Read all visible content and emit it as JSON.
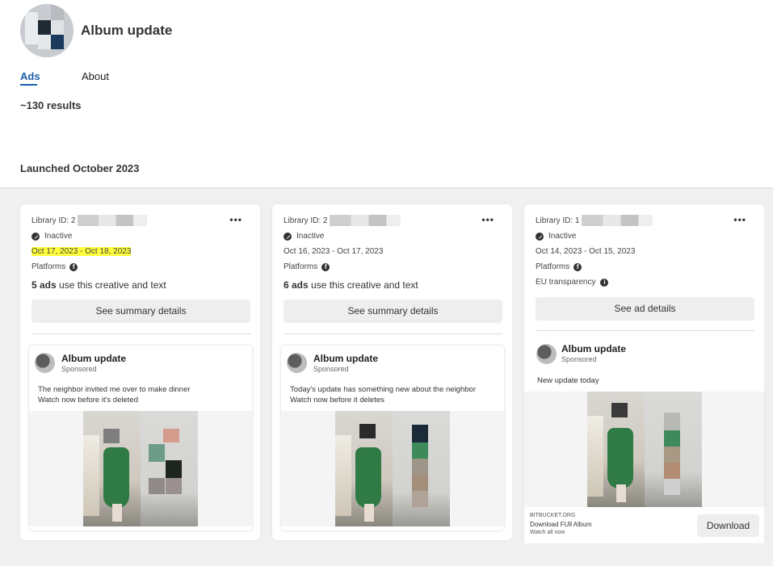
{
  "page": {
    "name": "Album update",
    "tabs": [
      {
        "label": "Ads",
        "active": true
      },
      {
        "label": "About",
        "active": false
      }
    ],
    "results": "~130 results",
    "section_title": "Launched October 2023",
    "accent_color": "#1a5ea8",
    "highlight_color": "#ffff3a"
  },
  "cards": [
    {
      "library_id_label": "Library ID: 2",
      "more_label": "•••",
      "status": "Inactive",
      "dates": "Oct 17, 2023 - Oct 18, 2023",
      "platforms_label": "Platforms",
      "ads_count": "5 ads",
      "ads_count_suffix": " use this creative and text",
      "details_button": "See summary details",
      "ad": {
        "name": "Album update",
        "sponsored": "Sponsored",
        "body_line1": "The neighbor invited me over to make dinner",
        "body_line2": "Watch now before it's deleted"
      }
    },
    {
      "library_id_label": "Library ID: 2",
      "more_label": "•••",
      "status": "Inactive",
      "dates": "Oct 16, 2023 - Oct 17, 2023",
      "platforms_label": "Platforms",
      "ads_count": "6 ads",
      "ads_count_suffix": " use this creative and text",
      "details_button": "See summary details",
      "ad": {
        "name": "Album update",
        "sponsored": "Sponsored",
        "body_line1": "Today's update has something new about the neighbor",
        "body_line2": "Watch now before it deletes"
      }
    },
    {
      "library_id_label": "Library ID: 1",
      "more_label": "•••",
      "status": "Inactive",
      "dates": "Oct 14, 2023 - Oct 15, 2023",
      "platforms_label": "Platforms",
      "eu_label": "EU transparency",
      "details_button": "See ad details",
      "ad": {
        "name": "Album update",
        "sponsored": "Sponsored",
        "body_line1": "New update today",
        "domain": "BITBUCKET.ORG",
        "title": "Download FUll Album",
        "subtitle": "Watch all now",
        "cta": "Download"
      }
    }
  ],
  "icons": [
    "check-circle-icon",
    "facebook-icon",
    "info-icon",
    "more-icon"
  ]
}
